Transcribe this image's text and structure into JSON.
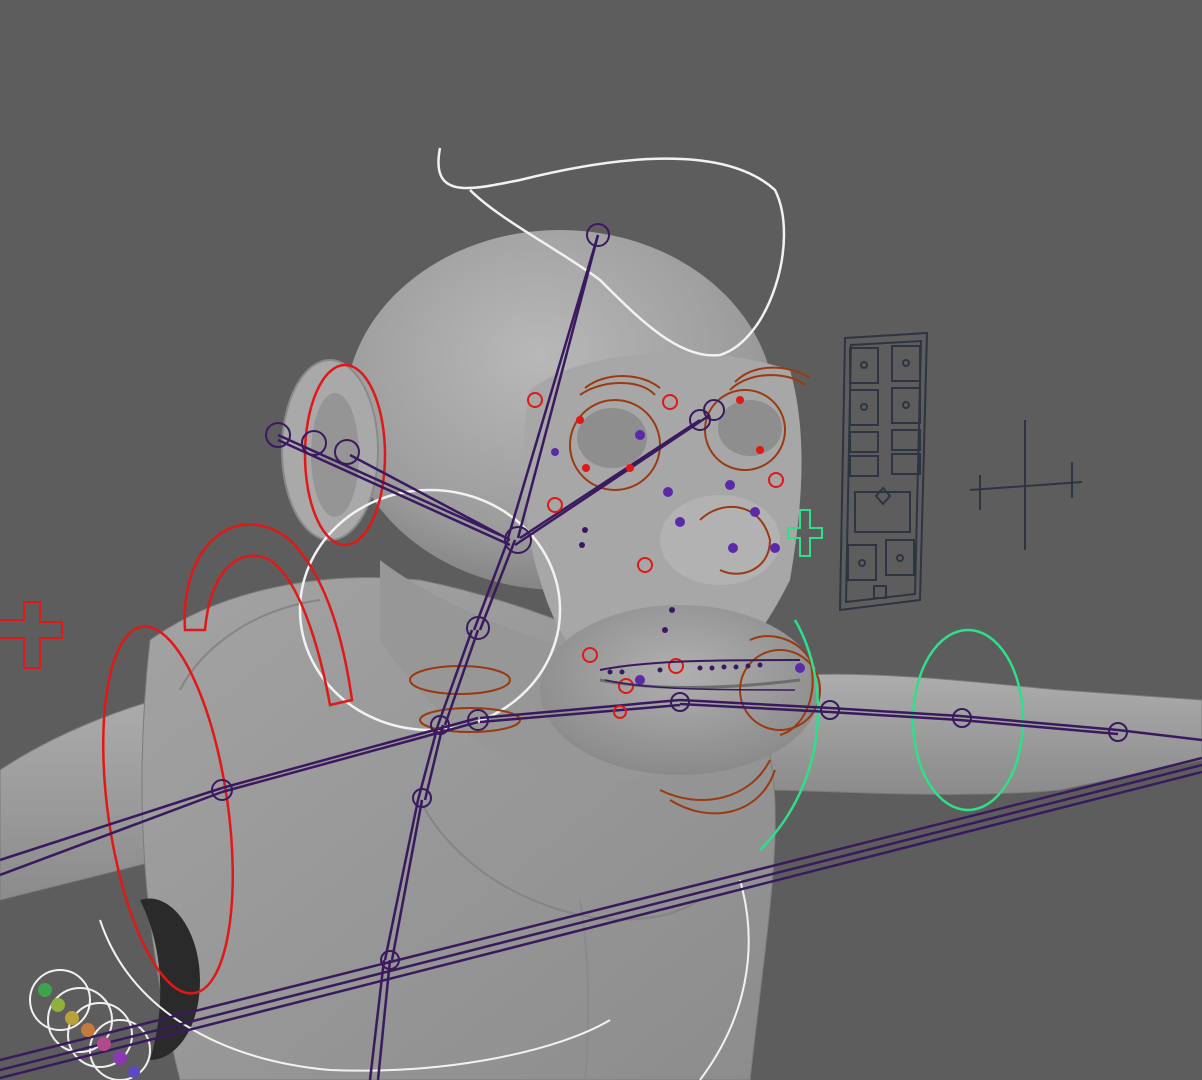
{
  "viewport": {
    "background": "#5d5d5d",
    "mesh_color": "#9a9a9a",
    "mesh_shadow": "#7c7c7c",
    "mesh_highlight": "#b4b4b4"
  },
  "rig_colors": {
    "joint": "#3a1a5e",
    "control_red": "#e01818",
    "control_brown": "#9a3a12",
    "control_green": "#2ee08a",
    "control_white": "#f2f2f2",
    "facial_point": "#5b2aa8",
    "face_panel": "#2e3440"
  },
  "scene": {
    "icons": [
      "torso-mesh",
      "arm-mesh",
      "head-mesh",
      "ear-mesh",
      "muzzle-mesh",
      "joint-chain",
      "nurbs-control-curve",
      "locator-cross",
      "face-control-panel"
    ]
  }
}
